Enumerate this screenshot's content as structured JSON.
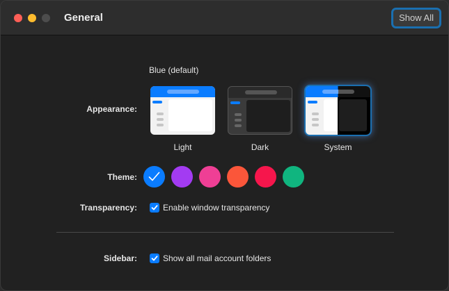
{
  "window": {
    "title": "General",
    "show_all_label": "Show All"
  },
  "appearance": {
    "label": "Appearance:",
    "current_theme": "Blue (default)",
    "options": [
      {
        "label": "Light",
        "selected": false
      },
      {
        "label": "Dark",
        "selected": false
      },
      {
        "label": "System",
        "selected": true
      }
    ]
  },
  "theme": {
    "label": "Theme:",
    "colors": [
      "#0a7cff",
      "#a33bf2",
      "#ef3f95",
      "#fb563a",
      "#f6164c",
      "#10b57f"
    ],
    "selected_index": 0
  },
  "transparency": {
    "label": "Transparency:",
    "checkbox_label": "Enable window transparency",
    "checked": true
  },
  "sidebar": {
    "label": "Sidebar:",
    "checkbox_label": "Show all mail account folders",
    "checked": true
  }
}
